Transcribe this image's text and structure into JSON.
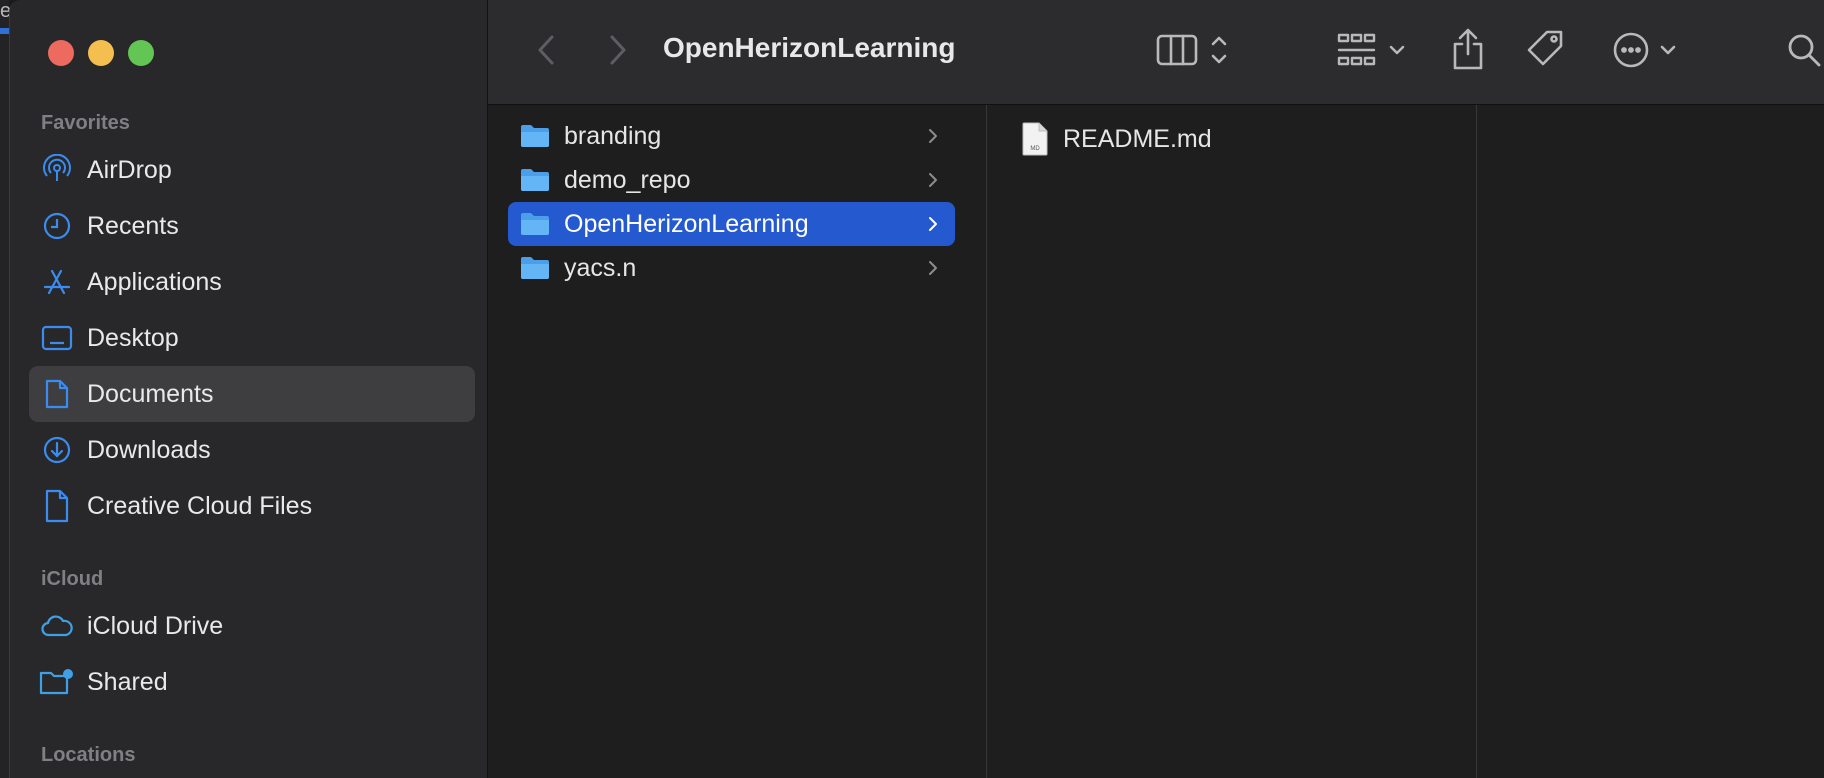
{
  "background_window": {
    "visible_char": "e"
  },
  "sidebar": {
    "sections": {
      "favorites": "Favorites",
      "icloud": "iCloud",
      "locations": "Locations"
    },
    "favorites": [
      {
        "label": "AirDrop",
        "icon": "airdrop-icon"
      },
      {
        "label": "Recents",
        "icon": "clock-icon"
      },
      {
        "label": "Applications",
        "icon": "applications-icon"
      },
      {
        "label": "Desktop",
        "icon": "desktop-icon"
      },
      {
        "label": "Documents",
        "icon": "document-icon",
        "selected": true
      },
      {
        "label": "Downloads",
        "icon": "download-icon"
      },
      {
        "label": "Creative Cloud Files",
        "icon": "file-icon"
      }
    ],
    "icloud": [
      {
        "label": "iCloud Drive",
        "icon": "cloud-icon"
      },
      {
        "label": "Shared",
        "icon": "shared-folder-icon"
      }
    ]
  },
  "toolbar": {
    "title": "OpenHerizonLearning",
    "icons": [
      "back-icon",
      "forward-icon",
      "column-view-icon",
      "group-icon",
      "share-icon",
      "tag-icon",
      "more-icon",
      "search-icon"
    ]
  },
  "columns": {
    "col1": [
      {
        "name": "branding",
        "type": "folder"
      },
      {
        "name": "demo_repo",
        "type": "folder"
      },
      {
        "name": "OpenHerizonLearning",
        "type": "folder",
        "selected": true
      },
      {
        "name": "yacs.n",
        "type": "folder"
      }
    ],
    "col2": [
      {
        "name": "README.md",
        "type": "file",
        "badge": "MD"
      }
    ]
  },
  "colors": {
    "accent": "#2459d0",
    "sidebar_icon": "#3b8cf0",
    "folder": "#5aaef2"
  }
}
